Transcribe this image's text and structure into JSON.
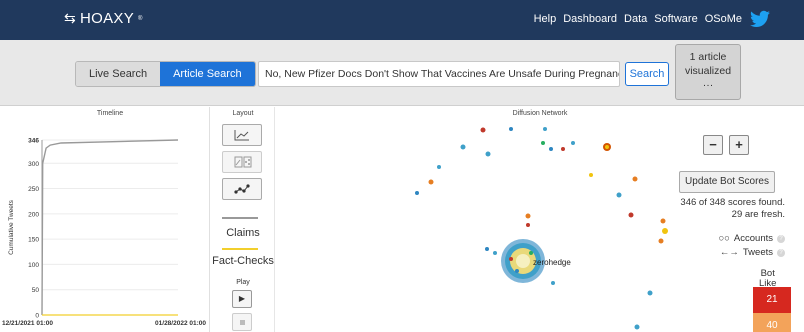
{
  "navbar": {
    "brand": "HOAXY",
    "brand_mark": "®",
    "links": [
      "Help",
      "Dashboard",
      "Data",
      "Software",
      "OSoMe"
    ],
    "icons": {
      "logo": "retweet-icon",
      "social": "twitter-icon"
    },
    "colors": {
      "background": "#20395d",
      "twitter": "#1da1f2"
    }
  },
  "search": {
    "modes": [
      "Live Search",
      "Article Search"
    ],
    "active_mode": "Article Search",
    "query": "No, New Pfizer Docs Don't Show That Vaccines Are Unsafe During Pregnancy",
    "button": "Search",
    "visualized": "1 article visualized",
    "more": "···",
    "colors": {
      "accent": "#1e73d8"
    }
  },
  "timeline": {
    "title": "Timeline",
    "ylabel": "Cumulative Tweets",
    "yticks": [
      "346",
      "300",
      "250",
      "200",
      "150",
      "100",
      "50",
      "0"
    ],
    "x_start": "12/21/2021 01:00",
    "x_end": "01/28/2022 01:00"
  },
  "chart_data": {
    "type": "line",
    "title": "Timeline",
    "ylabel": "Cumulative Tweets",
    "ylim": [
      0,
      346
    ],
    "series": [
      {
        "name": "Claims",
        "color": "#999999",
        "x": [
          "12/21/2021 01:00",
          "12/21/2021",
          "12/22/2021",
          "12/23/2021",
          "12/26/2021",
          "01/28/2022 01:00"
        ],
        "values": [
          0,
          300,
          330,
          336,
          340,
          346
        ]
      },
      {
        "name": "Fact-Checks",
        "color": "#f2cf2c",
        "x": [
          "12/21/2021 01:00",
          "01/28/2022 01:00"
        ],
        "values": [
          0,
          0
        ]
      }
    ]
  },
  "layout": {
    "title": "Layout",
    "claims": "Claims",
    "fact_checks": "Fact-Checks",
    "play": "Play"
  },
  "network": {
    "title": "Diffusion Network",
    "zoom_out": "−",
    "zoom_in": "+",
    "update_button": "Update Bot Scores",
    "scores_line1": "346 of 348 scores found.",
    "scores_line2": "29 are fresh.",
    "legend_accounts": "Accounts",
    "legend_tweets": "Tweets",
    "bot_label_1": "Bot",
    "bot_label_2": "Like",
    "bot_scores": [
      {
        "value": "21",
        "color": "#d6281f"
      },
      {
        "value": "40",
        "color": "#f3a35a"
      }
    ],
    "hub_label": "zerohedge"
  }
}
